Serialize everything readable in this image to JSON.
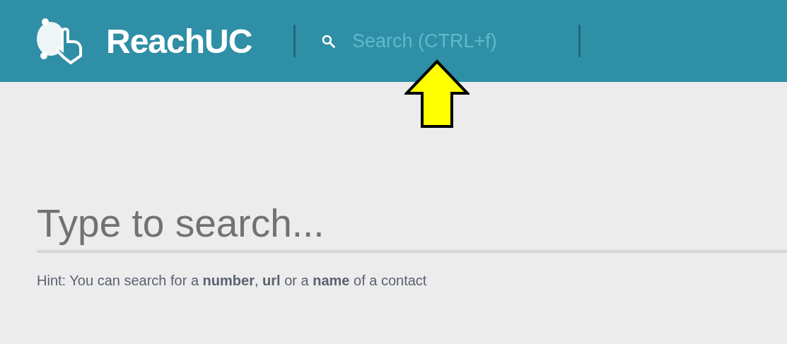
{
  "header": {
    "brand": "ReachUC",
    "search": {
      "placeholder": "Search (CTRL+f)"
    }
  },
  "main": {
    "search": {
      "placeholder": "Type to search..."
    },
    "hint": "Hint: You can search for a **number**, **url** or a **name** of a contact"
  }
}
